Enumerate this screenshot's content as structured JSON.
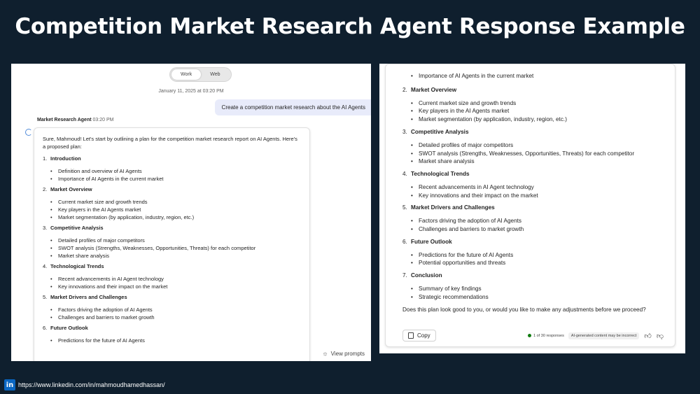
{
  "page_title": "Competition Market Research Agent Response Example",
  "left": {
    "toggle": [
      "Work",
      "Web"
    ],
    "date": "January 11, 2025 at 03:20 PM",
    "user_message": "Create a competition market research about the AI Agents",
    "agent_name": "Market Research Agent",
    "agent_time": "03:20 PM",
    "intro": "Sure, Mahmoud! Let's start by outlining a plan for the competition market research report on AI Agents. Here's a proposed plan:",
    "sections": [
      {
        "num": "1.",
        "title": "Introduction",
        "items": [
          "Definition and overview of AI Agents",
          "Importance of AI Agents in the current market"
        ]
      },
      {
        "num": "2.",
        "title": "Market Overview",
        "items": [
          "Current market size and growth trends",
          "Key players in the AI Agents market",
          "Market segmentation (by application, industry, region, etc.)"
        ]
      },
      {
        "num": "3.",
        "title": "Competitive Analysis",
        "items": [
          "Detailed profiles of major competitors",
          "SWOT analysis (Strengths, Weaknesses, Opportunities, Threats) for each competitor",
          "Market share analysis"
        ]
      },
      {
        "num": "4.",
        "title": "Technological Trends",
        "items": [
          "Recent advancements in AI Agent technology",
          "Key innovations and their impact on the market"
        ]
      },
      {
        "num": "5.",
        "title": "Market Drivers and Challenges",
        "items": [
          "Factors driving the adoption of AI Agents",
          "Challenges and barriers to market growth"
        ]
      },
      {
        "num": "6.",
        "title": "Future Outlook",
        "items": [
          "Predictions for the future of AI Agents"
        ]
      }
    ],
    "view_prompts": "View prompts"
  },
  "right": {
    "top_item": "Importance of AI Agents in the current market",
    "sections": [
      {
        "num": "2.",
        "title": "Market Overview",
        "items": [
          "Current market size and growth trends",
          "Key players in the AI Agents market",
          "Market segmentation (by application, industry, region, etc.)"
        ]
      },
      {
        "num": "3.",
        "title": "Competitive Analysis",
        "items": [
          "Detailed profiles of major competitors",
          "SWOT analysis (Strengths, Weaknesses, Opportunities, Threats) for each competitor",
          "Market share analysis"
        ]
      },
      {
        "num": "4.",
        "title": "Technological Trends",
        "items": [
          "Recent advancements in AI Agent technology",
          "Key innovations and their impact on the market"
        ]
      },
      {
        "num": "5.",
        "title": "Market Drivers and Challenges",
        "items": [
          "Factors driving the adoption of AI Agents",
          "Challenges and barriers to market growth"
        ]
      },
      {
        "num": "6.",
        "title": "Future Outlook",
        "items": [
          "Predictions for the future of AI Agents",
          "Potential opportunities and threats"
        ]
      },
      {
        "num": "7.",
        "title": "Conclusion",
        "items": [
          "Summary of key findings",
          "Strategic recommendations"
        ]
      }
    ],
    "question": "Does this plan look good to you, or would you like to make any adjustments before we proceed?",
    "copy_label": "Copy",
    "responses": "1 of 30 responses",
    "ai_notice": "AI-generated content may be incorrect"
  },
  "linkedin_url": "https://www.linkedin.com/in/mahmoudhamedhassan/",
  "icons": [
    "copy-icon",
    "thumbs-up-icon",
    "thumbs-down-icon",
    "view-prompts-icon",
    "linkedin-icon",
    "agent-loading-icon"
  ],
  "colors": {
    "background": "#0f1f2e",
    "user_bubble": "#e8ebfa",
    "linkedin": "#0a66c2",
    "status_dot": "#107c10"
  }
}
